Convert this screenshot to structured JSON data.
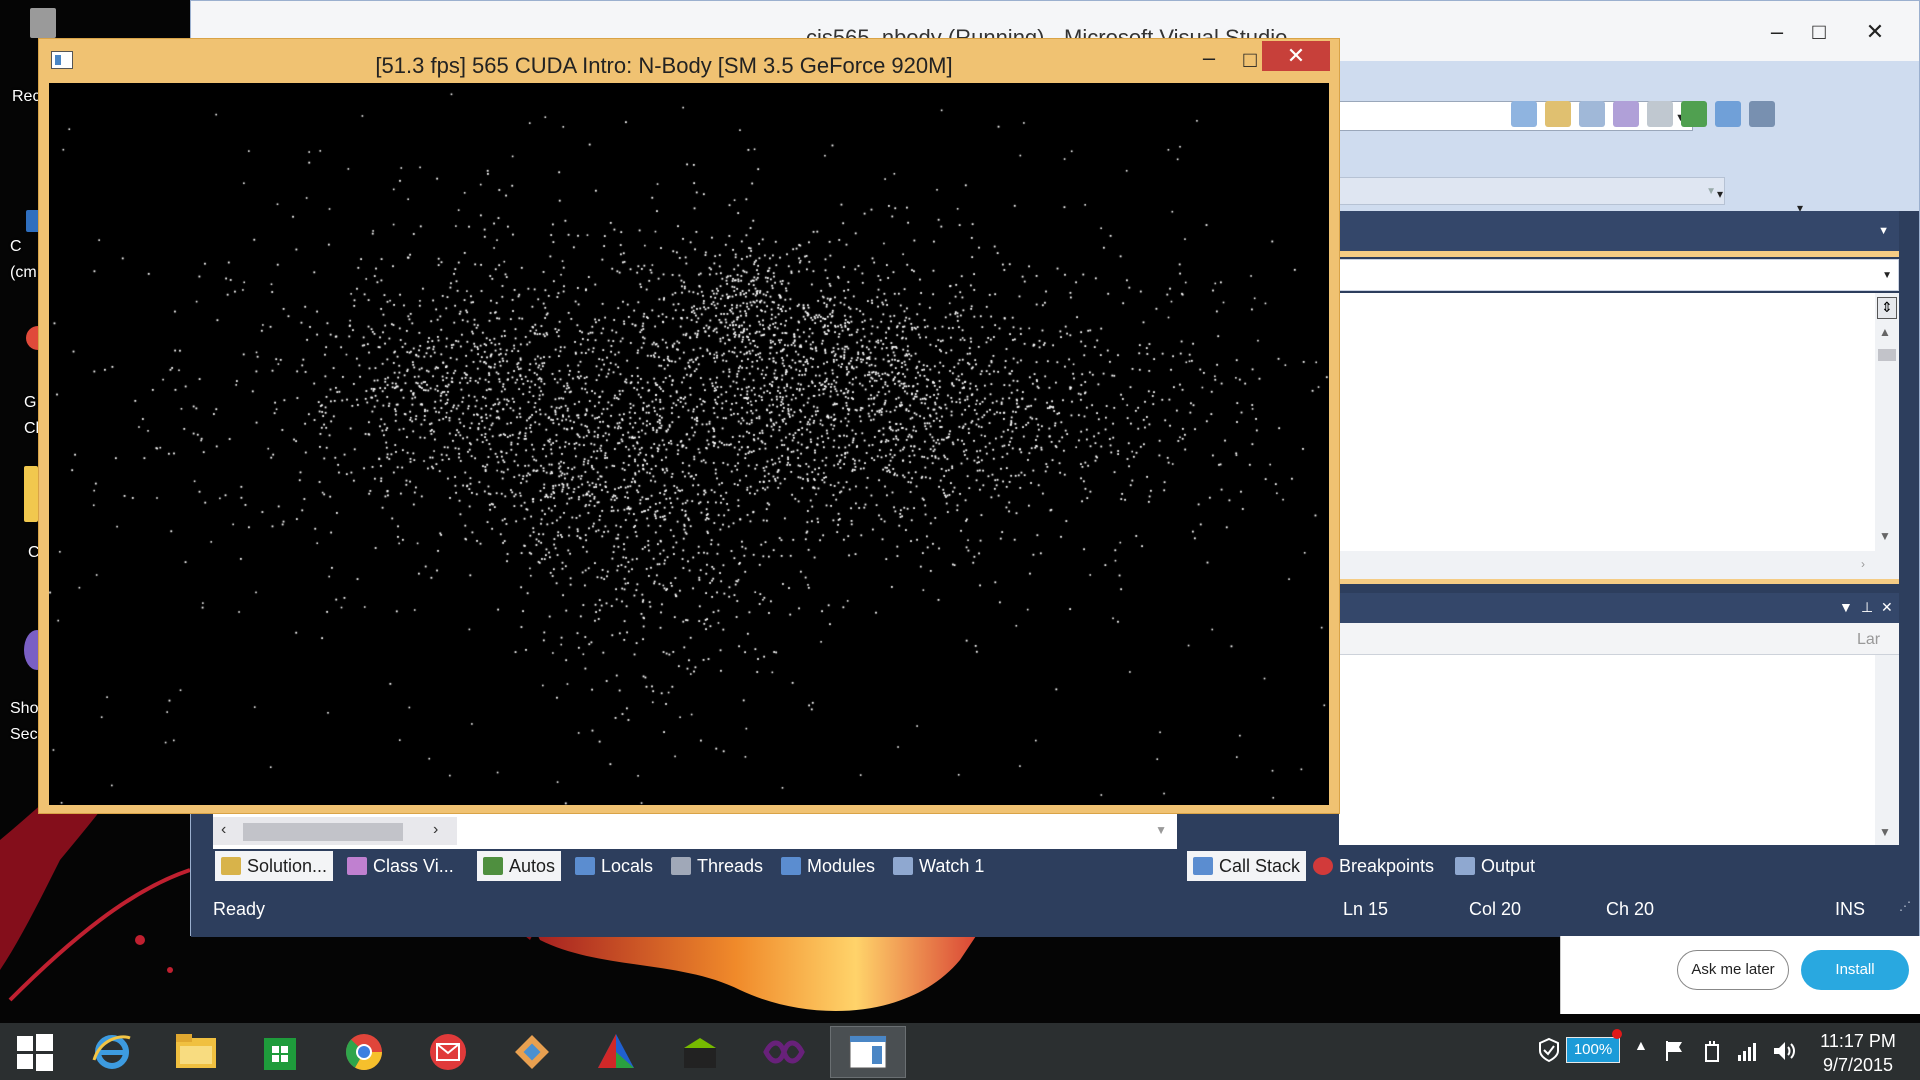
{
  "desktop": {
    "icons": [
      {
        "label": "Rec",
        "color": "#9a9a9a"
      },
      {
        "label": "C\n(cm",
        "color": "#2f6fbf"
      },
      {
        "label": "G\nCh",
        "color": "#e04a3a"
      },
      {
        "label": "C",
        "color": "#f1c84e"
      },
      {
        "label": "Sho\nSecu",
        "color": "#7a5fc4"
      }
    ]
  },
  "vs": {
    "title": "cis565_nbody (Running) - Microsoft Visual Studio",
    "tabs_left": [
      {
        "label": "Solution...",
        "icon": "solution-explorer-icon",
        "color": "#d8b34a"
      },
      {
        "label": "Class Vi...",
        "icon": "class-view-icon",
        "color": "#c080d0"
      }
    ],
    "tabs_mid": [
      {
        "label": "Autos",
        "icon": "autos-icon",
        "color": "#4f8f3f"
      },
      {
        "label": "Locals",
        "icon": "locals-icon",
        "color": "#5b8dd0"
      },
      {
        "label": "Threads",
        "icon": "threads-icon",
        "color": "#a0a8b8"
      },
      {
        "label": "Modules",
        "icon": "modules-icon",
        "color": "#5b8dd0"
      },
      {
        "label": "Watch 1",
        "icon": "watch-icon",
        "color": "#8fa8d0"
      }
    ],
    "tabs_right": [
      {
        "label": "Call Stack",
        "icon": "call-stack-icon",
        "color": "#5b8dd0"
      },
      {
        "label": "Breakpoints",
        "icon": "breakpoints-icon",
        "color": "#d23a3a"
      },
      {
        "label": "Output",
        "icon": "output-icon",
        "color": "#8fa8d0"
      }
    ],
    "output_lang_header": "Lar",
    "status": {
      "text": "Ready",
      "ln": "Ln 15",
      "col": "Col 20",
      "ch": "Ch 20",
      "mode": "INS"
    }
  },
  "nbody": {
    "title": "[51.3 fps] 565 CUDA Intro: N-Body [SM 3.5 GeForce 920M]",
    "particle_color": "#ffffff",
    "background": "#000000"
  },
  "install_prompt": {
    "later_label": "Ask me later",
    "install_label": "Install"
  },
  "taskbar": {
    "apps": [
      {
        "name": "start-button",
        "color": "#ffffff"
      },
      {
        "name": "internet-explorer-icon",
        "color": "#3d9be0"
      },
      {
        "name": "file-explorer-icon",
        "color": "#f0c040"
      },
      {
        "name": "store-icon",
        "color": "#1e9b3b"
      },
      {
        "name": "chrome-icon",
        "color": "#e0453a"
      },
      {
        "name": "mail-icon",
        "color": "#e03a3a"
      },
      {
        "name": "git-icon",
        "color": "#e8a050"
      },
      {
        "name": "cmake-icon",
        "color": "#2060d0"
      },
      {
        "name": "nsight-icon",
        "color": "#76b900"
      },
      {
        "name": "visual-studio-icon",
        "color": "#68217a"
      },
      {
        "name": "nbody-app-icon",
        "color": "#4a86c5"
      }
    ],
    "battery": "100%",
    "time": "11:17 PM",
    "date": "9/7/2015"
  }
}
